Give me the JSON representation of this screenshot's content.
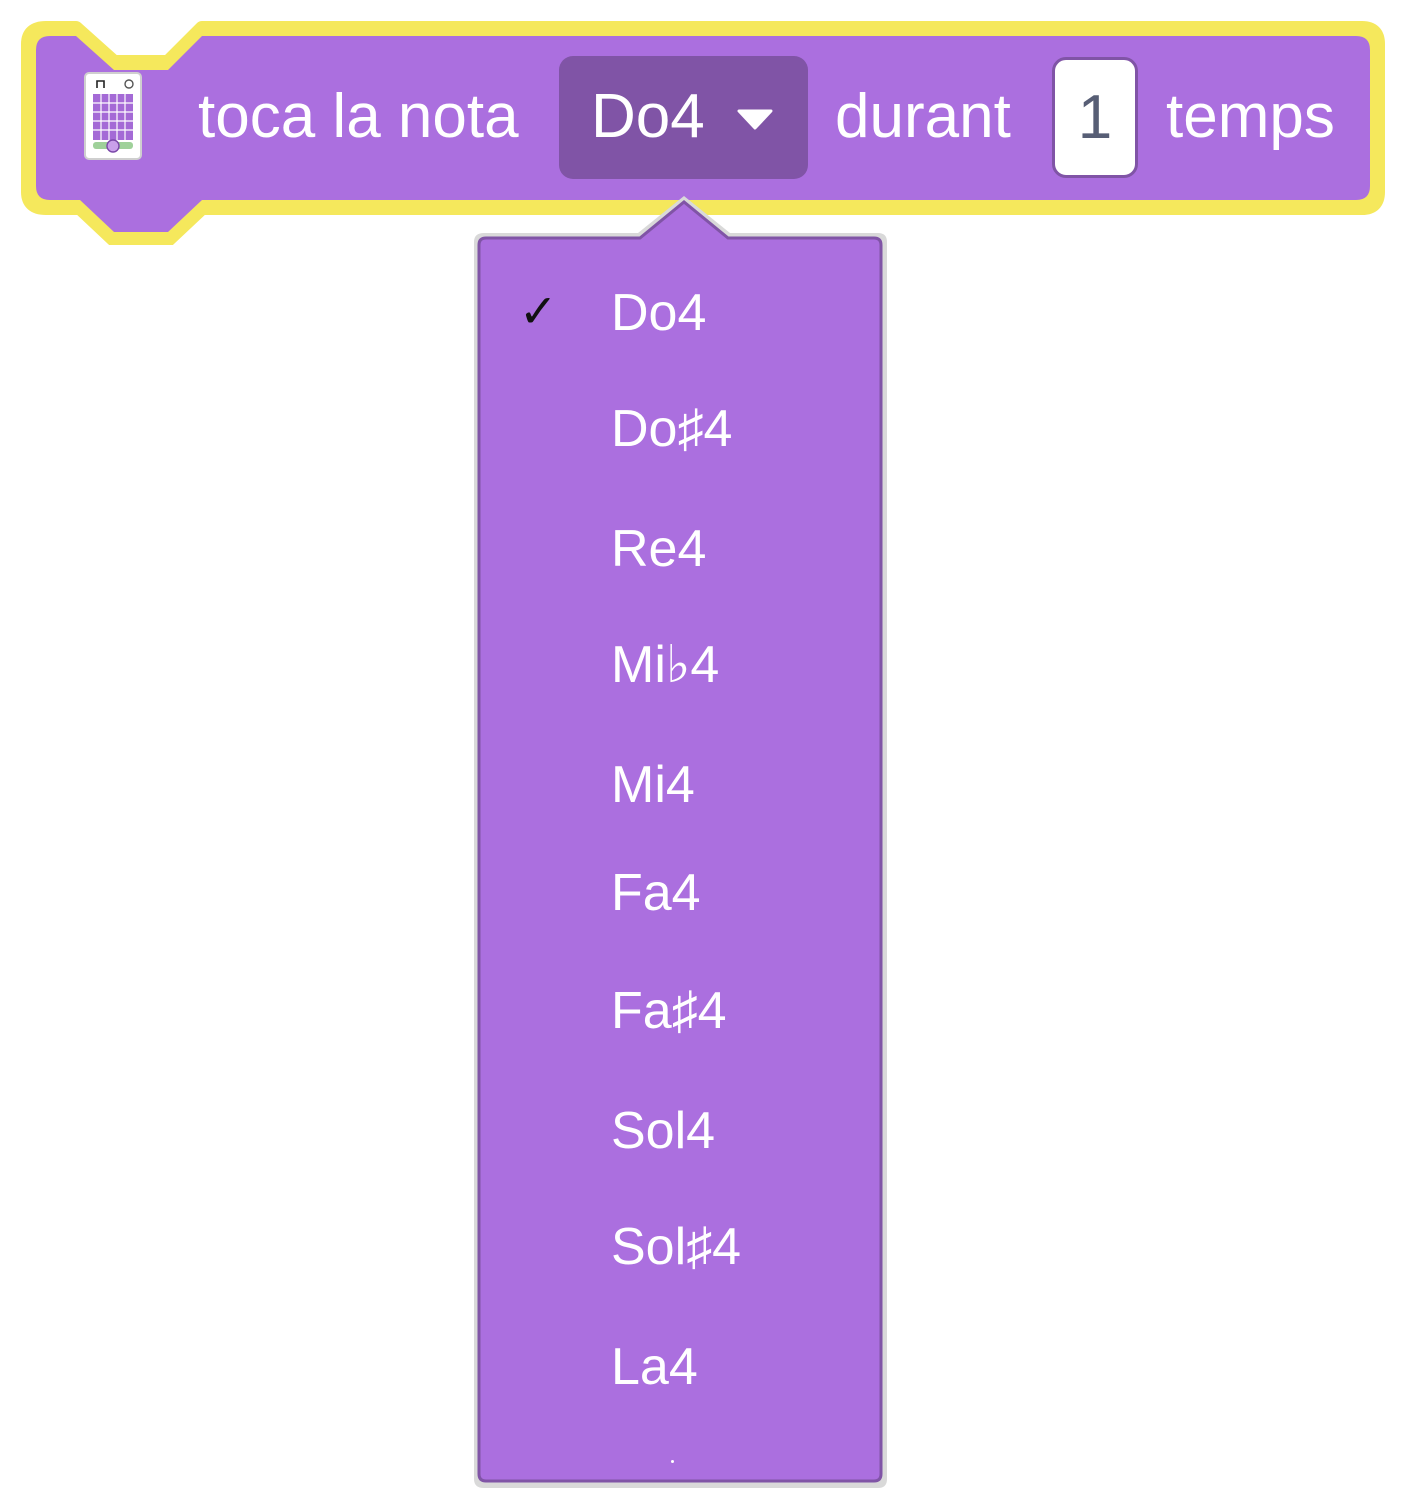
{
  "block": {
    "extension_icon": "microbit-icon",
    "label_play": "toca la nota",
    "note_value": "Do4",
    "label_during": "durant",
    "beats_value": "1",
    "label_beats": "temps"
  },
  "dropdown": {
    "selected_index": 0,
    "items": [
      {
        "label": "Do4"
      },
      {
        "label": "Do♯4"
      },
      {
        "label": "Re4"
      },
      {
        "label": "Mi♭4"
      },
      {
        "label": "Mi4"
      },
      {
        "label": "Fa4"
      },
      {
        "label": "Fa♯4"
      },
      {
        "label": "Sol4"
      },
      {
        "label": "Sol♯4"
      },
      {
        "label": "La4"
      }
    ]
  },
  "colors": {
    "block_fill": "#ab6fdf",
    "block_border": "#f5e85c",
    "field_fill": "#8054a6",
    "menu_fill": "#ab6fdf",
    "menu_border": "#8054a6",
    "text": "#ffffff",
    "input_text": "#575e75"
  }
}
